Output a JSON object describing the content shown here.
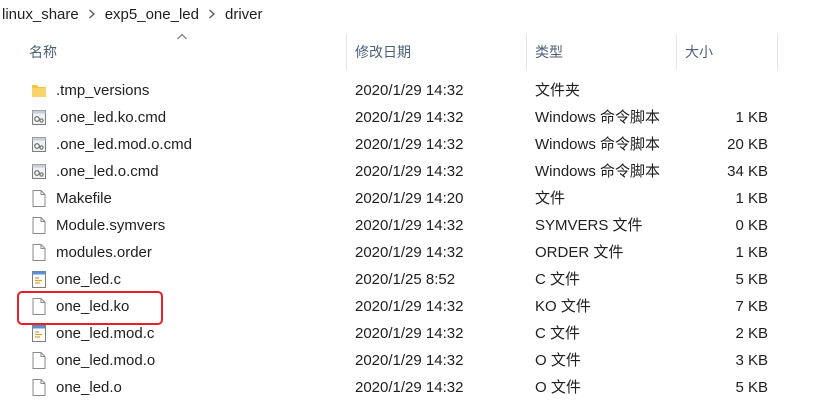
{
  "breadcrumb": [
    {
      "label": "linux_share"
    },
    {
      "label": "exp5_one_led"
    },
    {
      "label": "driver"
    }
  ],
  "columns": {
    "name": "名称",
    "date": "修改日期",
    "type": "类型",
    "size": "大小"
  },
  "files": [
    {
      "name": ".tmp_versions",
      "date": "2020/1/29 14:32",
      "type": "文件夹",
      "size": "",
      "icon": "folder-icon"
    },
    {
      "name": ".one_led.ko.cmd",
      "date": "2020/1/29 14:32",
      "type": "Windows 命令脚本",
      "size": "1 KB",
      "icon": "script-file-icon"
    },
    {
      "name": ".one_led.mod.o.cmd",
      "date": "2020/1/29 14:32",
      "type": "Windows 命令脚本",
      "size": "20 KB",
      "icon": "script-file-icon"
    },
    {
      "name": ".one_led.o.cmd",
      "date": "2020/1/29 14:32",
      "type": "Windows 命令脚本",
      "size": "34 KB",
      "icon": "script-file-icon"
    },
    {
      "name": "Makefile",
      "date": "2020/1/29 14:20",
      "type": "文件",
      "size": "1 KB",
      "icon": "blank-file-icon"
    },
    {
      "name": "Module.symvers",
      "date": "2020/1/29 14:32",
      "type": "SYMVERS 文件",
      "size": "0 KB",
      "icon": "blank-file-icon"
    },
    {
      "name": "modules.order",
      "date": "2020/1/29 14:32",
      "type": "ORDER 文件",
      "size": "1 KB",
      "icon": "blank-file-icon"
    },
    {
      "name": "one_led.c",
      "date": "2020/1/25 8:52",
      "type": "C 文件",
      "size": "5 KB",
      "icon": "c-source-file-icon"
    },
    {
      "name": "one_led.ko",
      "date": "2020/1/29 14:32",
      "type": "KO 文件",
      "size": "7 KB",
      "icon": "blank-file-icon"
    },
    {
      "name": "one_led.mod.c",
      "date": "2020/1/29 14:32",
      "type": "C 文件",
      "size": "2 KB",
      "icon": "c-source-file-icon"
    },
    {
      "name": "one_led.mod.o",
      "date": "2020/1/29 14:32",
      "type": "O 文件",
      "size": "3 KB",
      "icon": "blank-file-icon"
    },
    {
      "name": "one_led.o",
      "date": "2020/1/29 14:32",
      "type": "O 文件",
      "size": "5 KB",
      "icon": "blank-file-icon"
    }
  ],
  "colors": {
    "highlight": "#e8202a",
    "header_text": "#4c607a",
    "folder": "#f6c343"
  }
}
